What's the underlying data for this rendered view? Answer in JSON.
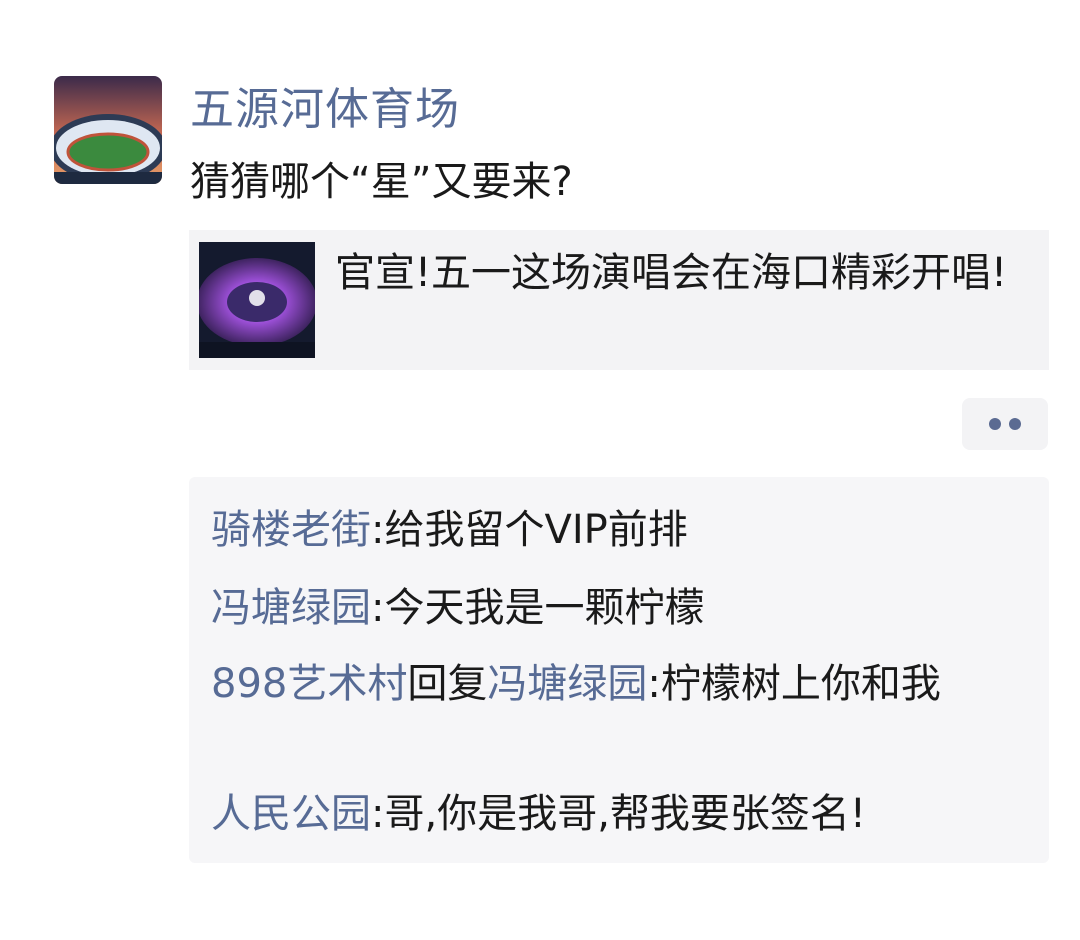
{
  "post": {
    "author": "五源河体育场",
    "text": "猜猜哪个“星”又要来?",
    "link": {
      "title": "官宣!五一这场演唱会在海口精彩开唱!"
    },
    "more_icon": "more-dots-icon"
  },
  "comments": [
    {
      "name": "骑楼老街",
      "sep": ":",
      "text": "给我留个VIP前排"
    },
    {
      "name": "冯塘绿园",
      "sep": ":",
      "text": "今天我是一颗柠檬"
    },
    {
      "name": "898艺术村",
      "reply_word": "回复",
      "reply_to": "冯塘绿园",
      "sep": ":",
      "text": "柠檬树上你和我"
    },
    {
      "name": "人民公园",
      "sep": ":",
      "text": "哥,你是我哥,帮我要张签名!"
    }
  ],
  "colors": {
    "name_blue": "#576b95",
    "text_dark": "#1a1a1a",
    "panel_gray": "#f3f3f5"
  }
}
